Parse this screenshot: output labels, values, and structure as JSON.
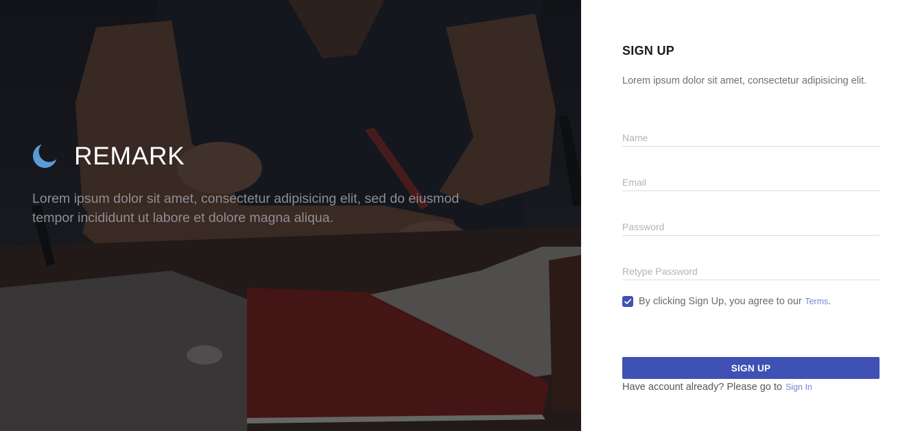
{
  "hero": {
    "brand_name": "REMARK",
    "brand_icon": "crescent-logo-icon",
    "tagline": "Lorem ipsum dolor sit amet, consectetur adipisicing elit, sed do eiusmod tempor incididunt ut labore et dolore magna aliqua."
  },
  "form": {
    "title": "SIGN UP",
    "subtitle": "Lorem ipsum dolor sit amet, consectetur adipisicing elit.",
    "fields": {
      "name": {
        "value": "",
        "placeholder": "Name"
      },
      "email": {
        "value": "",
        "placeholder": "Email"
      },
      "password": {
        "value": "",
        "placeholder": "Password"
      },
      "retype_password": {
        "value": "",
        "placeholder": "Retype Password"
      }
    },
    "terms": {
      "checked": true,
      "text": "By clicking Sign Up, you agree to our",
      "link_label": "Terms",
      "suffix": "."
    },
    "submit_label": "SIGN UP",
    "signin": {
      "text": "Have account already? Please go to",
      "link_label": "Sign In"
    }
  },
  "colors": {
    "primary": "#3f51b5",
    "link": "#7986cb",
    "logo": "#5b9bd5"
  }
}
